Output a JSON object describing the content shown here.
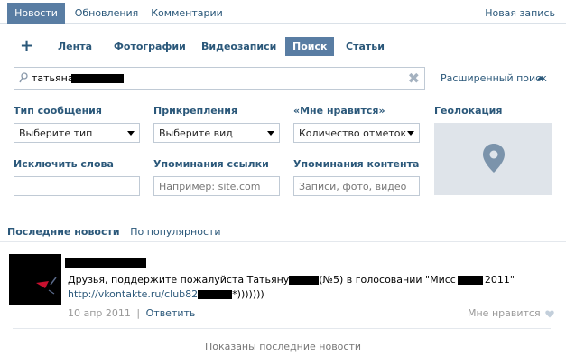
{
  "tabs": {
    "items": [
      "Новости",
      "Обновления",
      "Комментарии"
    ],
    "new_post": "Новая запись"
  },
  "subnav": {
    "plus": "+",
    "items": [
      "Лента",
      "Фотографии",
      "Видеозаписи",
      "Поиск",
      "Статьи"
    ],
    "active": "Поиск"
  },
  "search": {
    "value": "татьяна",
    "clear_icon": "close-icon",
    "advanced_label": "Расширенный поиск"
  },
  "filters": {
    "type_label": "Тип сообщения",
    "type_value": "Выберите тип",
    "attach_label": "Прикрепления",
    "attach_value": "Выберите вид",
    "likes_label": "«Мне нравится»",
    "likes_value": "Количество отметок",
    "geo_label": "Геолокация",
    "exclude_label": "Исключить слова",
    "link_label": "Упоминания ссылки",
    "link_placeholder": "Например: site.com",
    "content_label": "Упоминания контента",
    "content_placeholder": "Записи, фото, видео"
  },
  "sort": {
    "active": "Последние новости",
    "separator": "|",
    "other": "По популярности"
  },
  "post": {
    "text_1": "Друзья, поддержите пожалуйста Татьяну",
    "text_2": "(№5) в голосовании \"Мисс",
    "text_3": "2011\"",
    "link_1": "http://vkontakte.ru/club82",
    "link_2": "*)))))))",
    "date": "10 апр 2011",
    "meta_sep": "|",
    "reply": "Ответить",
    "like": "Мне нравится"
  },
  "footer": "Показаны последние новости",
  "colors": {
    "accent": "#597da3",
    "link": "#2b587a",
    "map_bg": "#dfe4ea",
    "pin": "#7b93ab"
  }
}
